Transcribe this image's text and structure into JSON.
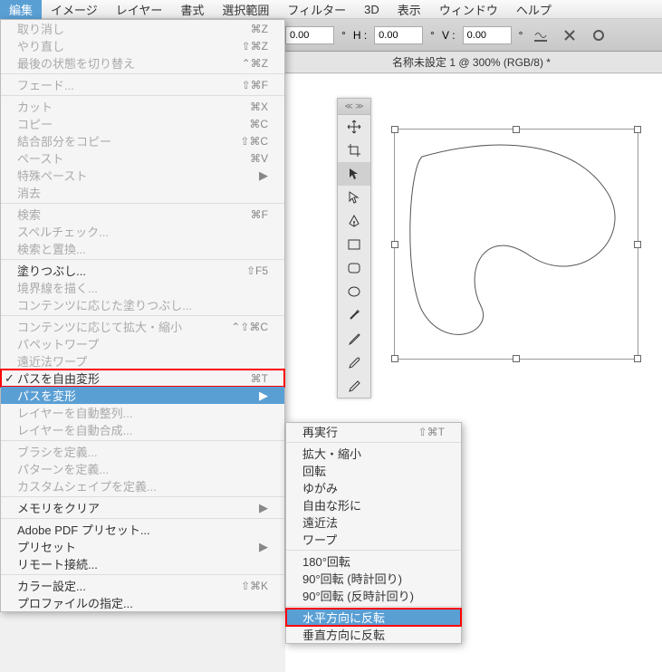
{
  "menubar": {
    "items": [
      "編集",
      "イメージ",
      "レイヤー",
      "書式",
      "選択範囲",
      "フィルター",
      "3D",
      "表示",
      "ウィンドウ",
      "ヘルプ"
    ]
  },
  "toolbar": {
    "val1": "0.00",
    "val2": "0.00",
    "h_label": "H :",
    "v_label": "V :",
    "h_val": "0.00",
    "v_val": "0.00",
    "deg": "°"
  },
  "tab": {
    "title": "名称未設定 1 @ 300% (RGB/8) *"
  },
  "menu": {
    "undo": "取り消し",
    "undo_sc": "⌘Z",
    "redo": "やり直し",
    "redo_sc": "⇧⌘Z",
    "toggle": "最後の状態を切り替え",
    "toggle_sc": "⌃⌘Z",
    "fade": "フェード...",
    "fade_sc": "⇧⌘F",
    "cut": "カット",
    "cut_sc": "⌘X",
    "copy": "コピー",
    "copy_sc": "⌘C",
    "copymerge": "結合部分をコピー",
    "copymerge_sc": "⇧⌘C",
    "paste": "ペースト",
    "paste_sc": "⌘V",
    "pastesp": "特殊ペースト",
    "clear": "消去",
    "find": "検索",
    "find_sc": "⌘F",
    "spell": "スペルチェック...",
    "replace": "検索と置換...",
    "fill": "塗りつぶし...",
    "fill_sc": "⇧F5",
    "stroke": "境界線を描く...",
    "contentfill": "コンテンツに応じた塗りつぶし...",
    "contentscale": "コンテンツに応じて拡大・縮小",
    "contentscale_sc": "⌃⇧⌘C",
    "puppet": "パペットワープ",
    "perspective": "遠近法ワープ",
    "freetransform": "パスを自由変形",
    "freetransform_sc": "⌘T",
    "transform": "パスを変形",
    "autoalign": "レイヤーを自動整列...",
    "autoblend": "レイヤーを自動合成...",
    "defbrush": "ブラシを定義...",
    "defpattern": "パターンを定義...",
    "defshape": "カスタムシェイプを定義...",
    "purge": "メモリをクリア",
    "pdfpreset": "Adobe PDF プリセット...",
    "preset": "プリセット",
    "remote": "リモート接続...",
    "colorsetting": "カラー設定...",
    "colorsetting_sc": "⇧⌘K",
    "assignprofile": "プロファイルの指定..."
  },
  "submenu": {
    "again": "再実行",
    "again_sc": "⇧⌘T",
    "scale": "拡大・縮小",
    "rotate": "回転",
    "skew": "ゆがみ",
    "distort": "自由な形に",
    "persp": "遠近法",
    "warp": "ワープ",
    "r180": "180°回転",
    "r90cw": "90°回転 (時計回り)",
    "r90ccw": "90°回転 (反時計回り)",
    "fliph": "水平方向に反転",
    "flipv": "垂直方向に反転"
  },
  "toolpanel": {
    "header": "≪  ≫"
  }
}
